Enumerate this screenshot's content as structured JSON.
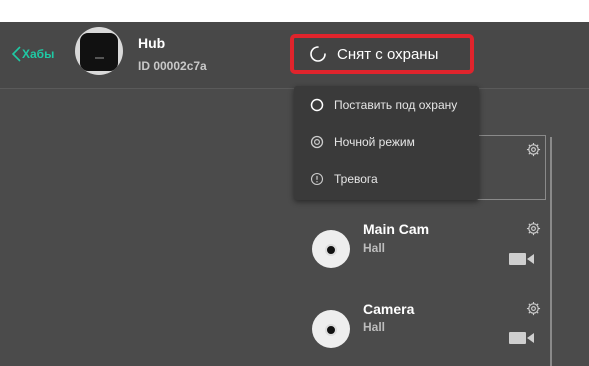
{
  "header": {
    "back_label": "Хабы",
    "hub_name": "Hub",
    "hub_id": "ID 00002c7a",
    "status_label": "Снят с охраны"
  },
  "dropdown": {
    "items": [
      {
        "label": "Поставить под охрану",
        "icon": "ring-icon"
      },
      {
        "label": "Ночной режим",
        "icon": "night-mode-icon"
      },
      {
        "label": "Тревога",
        "icon": "alarm-icon"
      }
    ]
  },
  "devices": [
    {
      "name": "Main Cam",
      "room": "Hall"
    },
    {
      "name": "Camera",
      "room": "Hall"
    }
  ],
  "colors": {
    "accent": "#1fc9a4",
    "status_border": "#e0242c",
    "background": "#4b4b4b"
  }
}
